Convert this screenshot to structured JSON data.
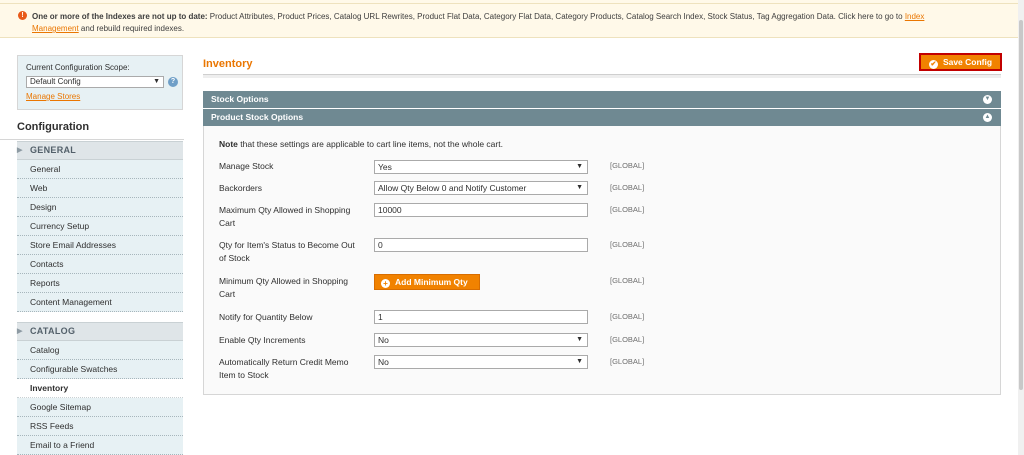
{
  "notice": {
    "bold_text": "One or more of the Indexes are not up to date:",
    "text": " Product Attributes, Product Prices, Catalog URL Rewrites, Product Flat Data, Category Flat Data, Category Products, Catalog Search Index, Stock Status, Tag Aggregation Data. Click here to go to ",
    "link1": "Index",
    "link2": "Management",
    "tail": " and rebuild required indexes."
  },
  "scope": {
    "label": "Current Configuration Scope:",
    "selected": "Default Config",
    "manage_stores": "Manage Stores"
  },
  "sidebar": {
    "title": "Configuration",
    "groups": [
      {
        "name": "GENERAL",
        "items": [
          "General",
          "Web",
          "Design",
          "Currency Setup",
          "Store Email Addresses",
          "Contacts",
          "Reports",
          "Content Management"
        ]
      },
      {
        "name": "CATALOG",
        "items": [
          "Catalog",
          "Configurable Swatches",
          "Inventory",
          "Google Sitemap",
          "RSS Feeds",
          "Email to a Friend"
        ]
      }
    ]
  },
  "main": {
    "title": "Inventory",
    "save_label": "Save Config",
    "sections": {
      "stock_options": "Stock Options",
      "product_stock_options": "Product Stock Options"
    },
    "note_bold": "Note",
    "note_text": " that these settings are applicable to cart line items, not the whole cart.",
    "rows": [
      {
        "label": "Manage Stock",
        "value": "Yes",
        "scope": "[GLOBAL]"
      },
      {
        "label": "Backorders",
        "value": "Allow Qty Below 0 and Notify Customer",
        "scope": "[GLOBAL]"
      },
      {
        "label": "Maximum Qty Allowed in Shopping Cart",
        "value": "10000",
        "scope": "[GLOBAL]"
      },
      {
        "label": "Qty for Item's Status to Become Out of Stock",
        "value": "0",
        "scope": "[GLOBAL]"
      },
      {
        "label": "Minimum Qty Allowed in Shopping Cart",
        "button": "Add Minimum Qty",
        "scope": "[GLOBAL]"
      },
      {
        "label": "Notify for Quantity Below",
        "value": "1",
        "scope": "[GLOBAL]"
      },
      {
        "label": "Enable Qty Increments",
        "value": "No",
        "scope": "[GLOBAL]"
      },
      {
        "label": "Automatically Return Credit Memo Item to Stock",
        "value": "No",
        "scope": "[GLOBAL]"
      }
    ]
  },
  "colors": {
    "accent_orange": "#f18200",
    "section_header": "#6f8992",
    "save_border": "#c20000"
  }
}
